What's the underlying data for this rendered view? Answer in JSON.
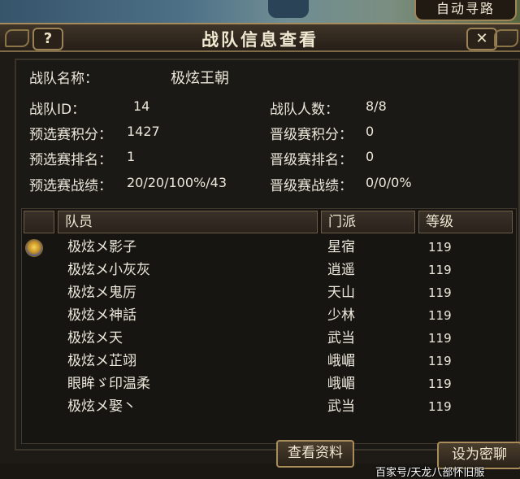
{
  "top": {
    "autopath_label": "自动寻路"
  },
  "window": {
    "title": "战队信息查看",
    "help_label": "?",
    "close_label": "✕"
  },
  "team": {
    "name_label": "战队名称：",
    "name_value": "极炫王朝",
    "id_label": "战队ID：",
    "id_value": "14",
    "members_label": "战队人数：",
    "members_value": "8/8",
    "prelim_points_label": "预选赛积分：",
    "prelim_points_value": "1427",
    "promo_points_label": "晋级赛积分：",
    "promo_points_value": "0",
    "prelim_rank_label": "预选赛排名：",
    "prelim_rank_value": "1",
    "promo_rank_label": "晋级赛排名：",
    "promo_rank_value": "0",
    "prelim_record_label": "预选赛战绩：",
    "prelim_record_value": "20/20/100%/43",
    "promo_record_label": "晋级赛战绩：",
    "promo_record_value": "0/0/0%"
  },
  "columns": {
    "member": "队员",
    "school": "门派",
    "level": "等级"
  },
  "members": [
    {
      "name": "极炫メ影子",
      "school": "星宿",
      "level": "119"
    },
    {
      "name": "极炫メ小灰灰",
      "school": "逍遥",
      "level": "119"
    },
    {
      "name": "极炫メ鬼厉",
      "school": "天山",
      "level": "119"
    },
    {
      "name": "极炫メ神話",
      "school": "少林",
      "level": "119"
    },
    {
      "name": "极炫メ天",
      "school": "武当",
      "level": "119"
    },
    {
      "name": "极炫メ芷翊",
      "school": "峨嵋",
      "level": "119"
    },
    {
      "name": "眼眸ゞ印温柔",
      "school": "峨嵋",
      "level": "119"
    },
    {
      "name": "极炫メ娶丶",
      "school": "武当",
      "level": "119"
    }
  ],
  "buttons": {
    "view_info": "查看资料",
    "settings": "设为密聊"
  },
  "watermark": "百家号/天龙八部怀旧服"
}
